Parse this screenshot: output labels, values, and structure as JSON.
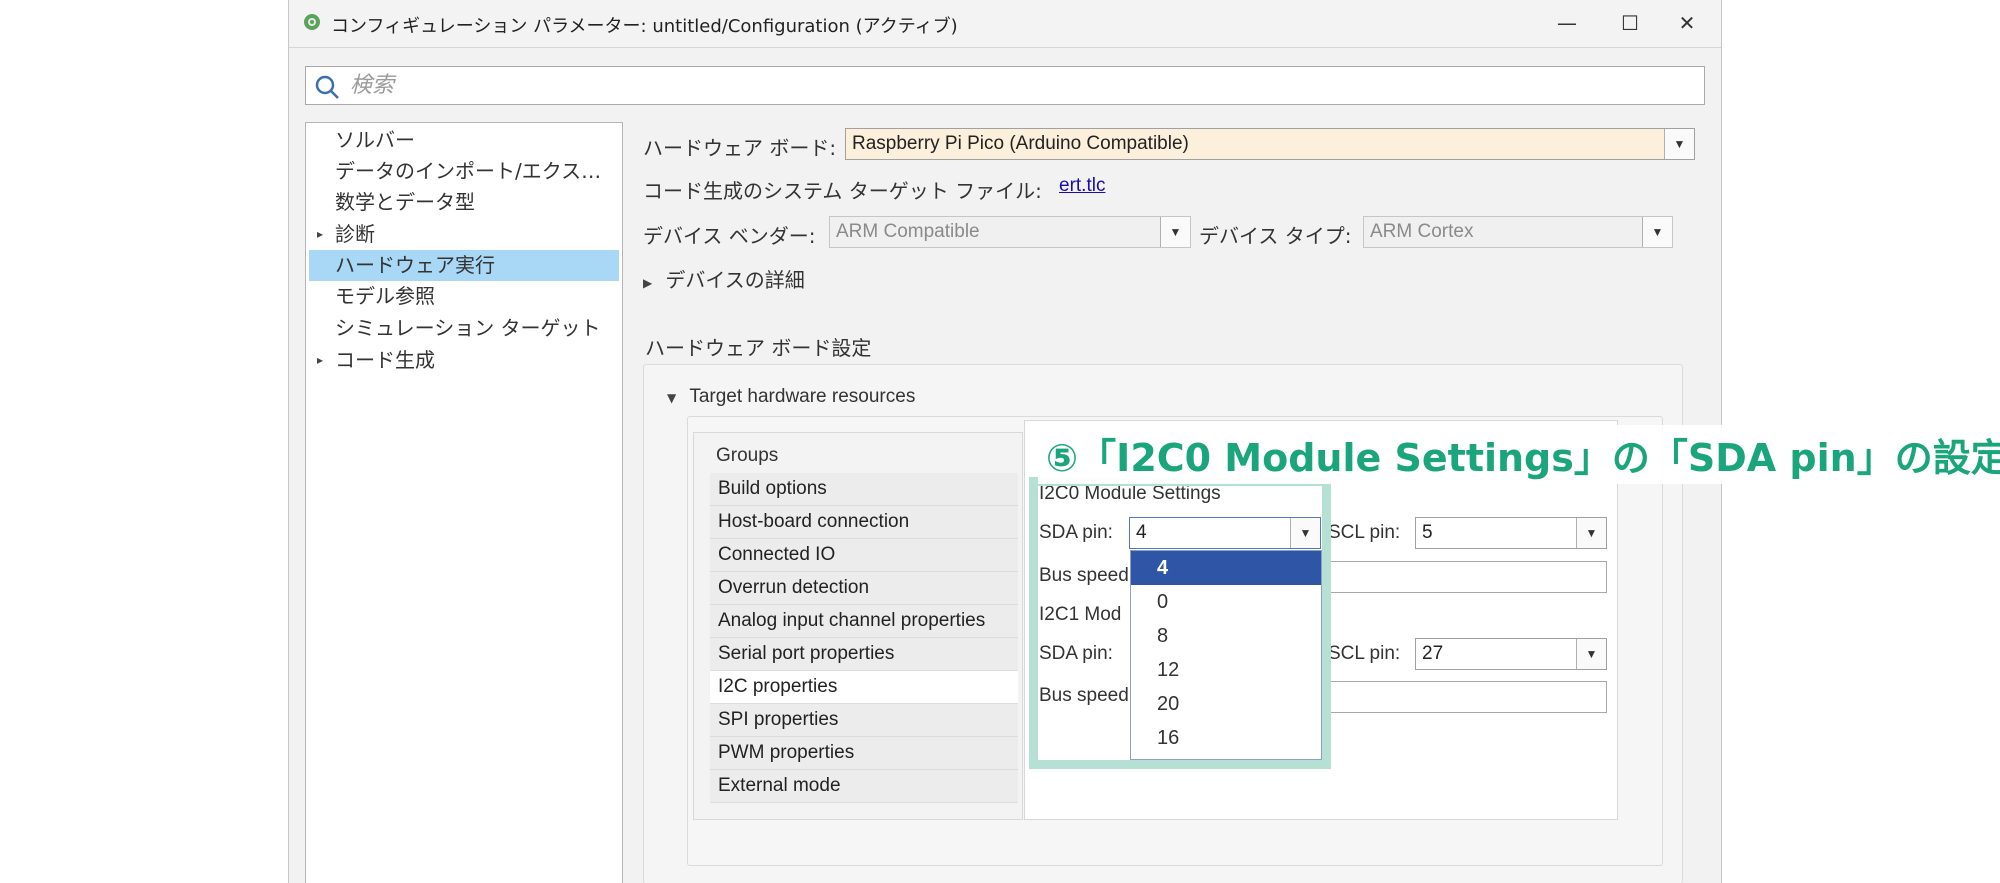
{
  "window": {
    "title": "コンフィギュレーション パラメーター: untitled/Configuration (アクティブ)",
    "minimize": "—",
    "maximize": "☐",
    "close": "✕"
  },
  "search": {
    "placeholder": "検索"
  },
  "sidebar": {
    "items": [
      {
        "label": "ソルバー",
        "arrow": ""
      },
      {
        "label": "データのインポート/エクス…",
        "arrow": ""
      },
      {
        "label": "数学とデータ型",
        "arrow": ""
      },
      {
        "label": "診断",
        "arrow": "▸"
      },
      {
        "label": "ハードウェア実行",
        "arrow": "",
        "selected": true
      },
      {
        "label": "モデル参照",
        "arrow": ""
      },
      {
        "label": "シミュレーション ターゲット",
        "arrow": ""
      },
      {
        "label": "コード生成",
        "arrow": "▸"
      }
    ]
  },
  "hardware": {
    "board_label": "ハードウェア ボード:",
    "board_value": "Raspberry Pi Pico (Arduino Compatible)",
    "target_file_label": "コード生成のシステム ターゲット ファイル:",
    "target_file_link": "ert.tlc",
    "vendor_label": "デバイス ベンダー:",
    "vendor_value": "ARM Compatible",
    "type_label": "デバイス タイプ:",
    "type_value": "ARM Cortex",
    "device_details": "デバイスの詳細",
    "board_settings_title": "ハードウェア ボード設定",
    "target_resources": "Target hardware resources"
  },
  "groups": {
    "title": "Groups",
    "items": [
      "Build options",
      "Host-board connection",
      "Connected IO",
      "Overrun detection",
      "Analog input channel properties",
      "Serial port properties",
      "I2C properties",
      "SPI properties",
      "PWM properties",
      "External mode"
    ],
    "active_index": 6
  },
  "i2c": {
    "i2c0_title": "I2C0 Module Settings",
    "sda_label": "SDA pin:",
    "sda_value": "4",
    "scl_label": "SCL pin:",
    "scl0_value": "5",
    "bus_speed_label": "Bus speed",
    "i2c1_title": "I2C1 Mod",
    "sda1_label": "SDA pin:",
    "scl1_label": "SCL pin:",
    "scl1_value": "27",
    "bus_speed1_label": "Bus speed"
  },
  "dropdown": {
    "options": [
      "4",
      "0",
      "8",
      "12",
      "20",
      "16"
    ],
    "selected_index": 0
  },
  "caption": "⑤「I2C0 Module Settings」の「SDA pin」の設定",
  "colors": {
    "caption": "#1aa57d",
    "frame": "#b7e0d4",
    "selection": "#a9d8f7",
    "option_selected": "#2f55a6"
  }
}
